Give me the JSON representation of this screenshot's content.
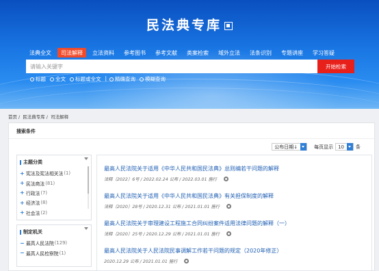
{
  "site": {
    "title": "民法典专库"
  },
  "nav": [
    {
      "label": "法典全文",
      "active": false
    },
    {
      "label": "司法解释",
      "active": true
    },
    {
      "label": "立法资料",
      "active": false
    },
    {
      "label": "参考图书",
      "active": false
    },
    {
      "label": "参考文献",
      "active": false
    },
    {
      "label": "类案检索",
      "active": false
    },
    {
      "label": "域外立法",
      "active": false
    },
    {
      "label": "法条识别",
      "active": false
    },
    {
      "label": "专题讲座",
      "active": false
    },
    {
      "label": "学习答疑",
      "active": false
    }
  ],
  "search": {
    "placeholder": "请输入关键字",
    "button": "开始检索"
  },
  "scope_options": [
    {
      "label": "标题",
      "checked": true
    },
    {
      "label": "全文",
      "checked": false
    },
    {
      "label": "标题或全文",
      "checked": false
    }
  ],
  "match_options": [
    {
      "label": "精确查询",
      "checked": true
    },
    {
      "label": "模糊查询",
      "checked": false
    }
  ],
  "breadcrumb": [
    "首页",
    "民法典专库",
    "司法解释"
  ],
  "panel": {
    "title": "搜索条件"
  },
  "sort": {
    "value": "公布日期↓",
    "per_page_label": "每页显示",
    "per_page_value": "10",
    "unit": "条"
  },
  "topic_box": {
    "title": "主题分类",
    "items": [
      {
        "label": "宪法及宪法相关法",
        "count": "(1)"
      },
      {
        "label": "民法商法",
        "count": "(81)"
      },
      {
        "label": "行政法",
        "count": "(7)"
      },
      {
        "label": "经济法",
        "count": "(8)"
      },
      {
        "label": "社会法",
        "count": "(2)"
      }
    ]
  },
  "authority_box": {
    "title": "制定机关",
    "items": [
      {
        "label": "最高人民法院",
        "count": "(129)"
      },
      {
        "label": "最高人民检察院",
        "count": "(1)"
      }
    ]
  },
  "results": [
    {
      "title": "最高人民法院关于适用《中华人民共和国民法典》总则编若干问题的解释",
      "meta": "法释〔2022〕6号 / 2022.02.24 公布 / 2022.03.01 施行"
    },
    {
      "title": "最高人民法院关于适用《中华人民共和国民法典》有关担保制度的解释",
      "meta": "法释〔2020〕28号 / 2020.12.31 公布 / 2021.01.01 施行"
    },
    {
      "title": "最高人民法院关于审理建设工程施工合同纠纷案件适用法律问题的解释（一）",
      "meta": "法释〔2020〕25号 / 2020.12.29 公布 / 2021.01.01 施行"
    },
    {
      "title": "最高人民法院关于人民法院民事调解工作若干问题的规定（2020年修正）",
      "meta": "2020.12.29 公布 / 2021.01.01 施行"
    }
  ],
  "colors": {
    "accent": "#1f5fb3",
    "active_tab": "#f04b2b",
    "search_button": "#e8201c",
    "banner": "#1976e3"
  }
}
